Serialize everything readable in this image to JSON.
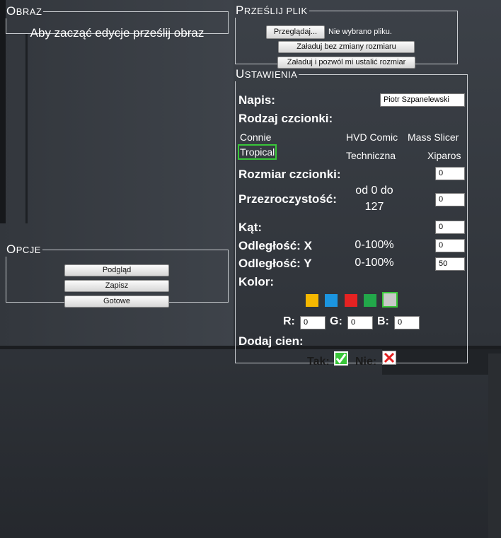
{
  "obraz": {
    "legend": "Obraz",
    "message": "Aby zacząć edycje prześlij obraz"
  },
  "upload": {
    "legend": "Prześlij plik",
    "browse_label": "Przeglądaj...",
    "no_file_text": "Nie wybrano pliku.",
    "upload_no_resize": "Załaduj bez zmiany rozmiaru",
    "upload_resize": "Załaduj i pozwól mi ustalić rozmiar"
  },
  "options": {
    "legend": "Opcje",
    "preview": "Podgląd",
    "save": "Zapisz",
    "done": "Gotowe"
  },
  "settings": {
    "legend": "Ustawienia",
    "caption_label": "Napis:",
    "caption_value": "Piotr Szpanelewski",
    "font_type_label": "Rodzaj czcionki:",
    "fonts": [
      "Connie",
      "HVD Comic",
      "Mass Slicer",
      "Tropical",
      "Techniczna",
      "Xiparos"
    ],
    "selected_font": "Tropical",
    "font_size_label": "Rozmiar czcionki:",
    "font_size_value": "0",
    "opacity_label": "Przezroczystość:",
    "opacity_range_line1": "od 0 do",
    "opacity_range_line2": "127",
    "opacity_value": "0",
    "angle_label": "Kąt:",
    "angle_value": "0",
    "offset_x_label": "Odległość: X",
    "offset_x_range": "0-100%",
    "offset_x_value": "0",
    "offset_y_label": "Odległość: Y",
    "offset_y_range": "0-100%",
    "offset_y_value": "50",
    "color_label": "Kolor:",
    "swatches": [
      "#f5b800",
      "#1b95e0",
      "#e52222",
      "#22a84a",
      "#c8c8c8"
    ],
    "selected_swatch_border": "#39c639",
    "r_label": "R:",
    "r_value": "0",
    "g_label": "G:",
    "g_value": "0",
    "b_label": "B:",
    "b_value": "0",
    "shadow_label": "Dodaj cien:",
    "yes_label": "Tak:",
    "no_label": "Nie:"
  }
}
